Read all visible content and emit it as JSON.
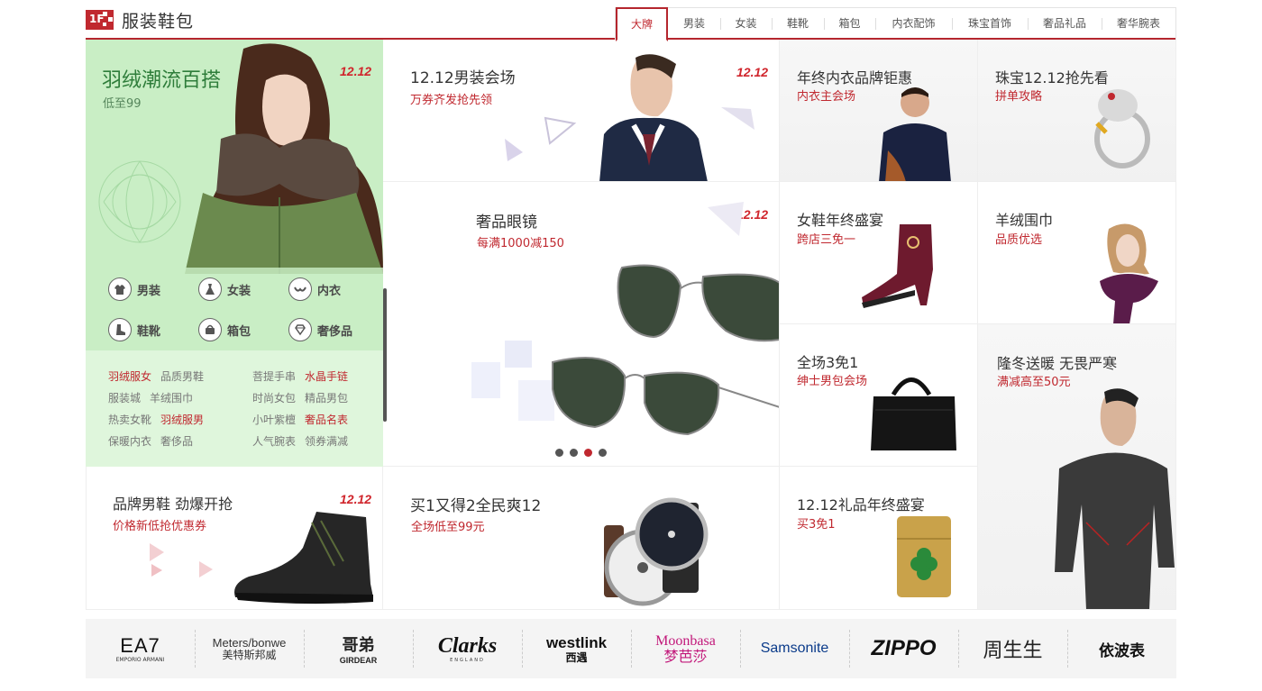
{
  "header": {
    "badge": "1F",
    "title": "服装鞋包",
    "accent": "#c0282f",
    "tabs": [
      {
        "label": "大牌",
        "active": true
      },
      {
        "label": "男装"
      },
      {
        "label": "女装"
      },
      {
        "label": "鞋靴"
      },
      {
        "label": "箱包"
      },
      {
        "label": "内衣配饰"
      },
      {
        "label": "珠宝首饰"
      },
      {
        "label": "奢品礼品"
      },
      {
        "label": "奢华腕表"
      }
    ]
  },
  "left_banner": {
    "title": "羽绒潮流百搭",
    "subtitle": "低至99",
    "badge": "12.12",
    "categories": [
      {
        "label": "男装",
        "icon": "shirt-icon"
      },
      {
        "label": "女装",
        "icon": "dress-icon"
      },
      {
        "label": "内衣",
        "icon": "bra-icon"
      },
      {
        "label": "鞋靴",
        "icon": "boot-icon"
      },
      {
        "label": "箱包",
        "icon": "bag-icon"
      },
      {
        "label": "奢侈品",
        "icon": "diamond-icon"
      }
    ],
    "links": [
      {
        "label": "羽绒服女",
        "red": true
      },
      {
        "label": "品质男鞋"
      },
      {
        "label": "菩提手串"
      },
      {
        "label": "水晶手链",
        "red": true
      },
      {
        "label": "服装城"
      },
      {
        "label": "羊绒围巾"
      },
      {
        "label": "时尚女包"
      },
      {
        "label": "精品男包"
      },
      {
        "label": "热卖女靴"
      },
      {
        "label": "羽绒服男",
        "red": true
      },
      {
        "label": "小叶紫檀"
      },
      {
        "label": "奢品名表",
        "red": true
      },
      {
        "label": "保暖内衣"
      },
      {
        "label": "奢侈品"
      },
      {
        "label": "人气腕表"
      },
      {
        "label": "领券满减"
      }
    ]
  },
  "tiles": {
    "mens_shoes": {
      "title": "品牌男鞋 劲爆开抢",
      "subtitle": "价格新低抢优惠券",
      "badge": "12.12"
    },
    "mens_wear": {
      "title": "12.12男装会场",
      "subtitle": "万券齐发抢先领",
      "badge": "12.12"
    },
    "glasses": {
      "title": "奢品眼镜",
      "subtitle": "每满1000减150",
      "badge": "12.12"
    },
    "watches": {
      "title": "买1又得2全民爽12",
      "subtitle": "全场低至99元"
    },
    "underwear": {
      "title": "年终内衣品牌钜惠",
      "subtitle": "内衣主会场"
    },
    "jewelry": {
      "title": "珠宝12.12抢先看",
      "subtitle": "拼单攻略"
    },
    "womens_shoes": {
      "title": "女鞋年终盛宴",
      "subtitle": "跨店三免一"
    },
    "scarf": {
      "title": "羊绒围巾",
      "subtitle": "品质优选"
    },
    "bags": {
      "title": "全场3免1",
      "subtitle": "绅士男包会场"
    },
    "thermal": {
      "title": "隆冬送暖 无畏严寒",
      "subtitle": "满减高至50元"
    },
    "gifts": {
      "title": "12.12礼品年终盛宴",
      "subtitle": "买3免1"
    }
  },
  "carousel": {
    "count": 4,
    "active": 3
  },
  "brands": [
    {
      "label": "EA7",
      "sub": "EMPORIO ARMANI"
    },
    {
      "label": "Meters/bonwe",
      "sub": "美特斯邦威"
    },
    {
      "label": "哥弟",
      "sub": "GIRDEAR"
    },
    {
      "label": "Clarks",
      "sub": "ENGLAND"
    },
    {
      "label": "westlink",
      "sub": "西遇"
    },
    {
      "label": "Moonbasa",
      "sub": "梦芭莎"
    },
    {
      "label": "Samsonite"
    },
    {
      "label": "ZIPPO"
    },
    {
      "label": "周生生"
    },
    {
      "label": "依波表"
    }
  ]
}
